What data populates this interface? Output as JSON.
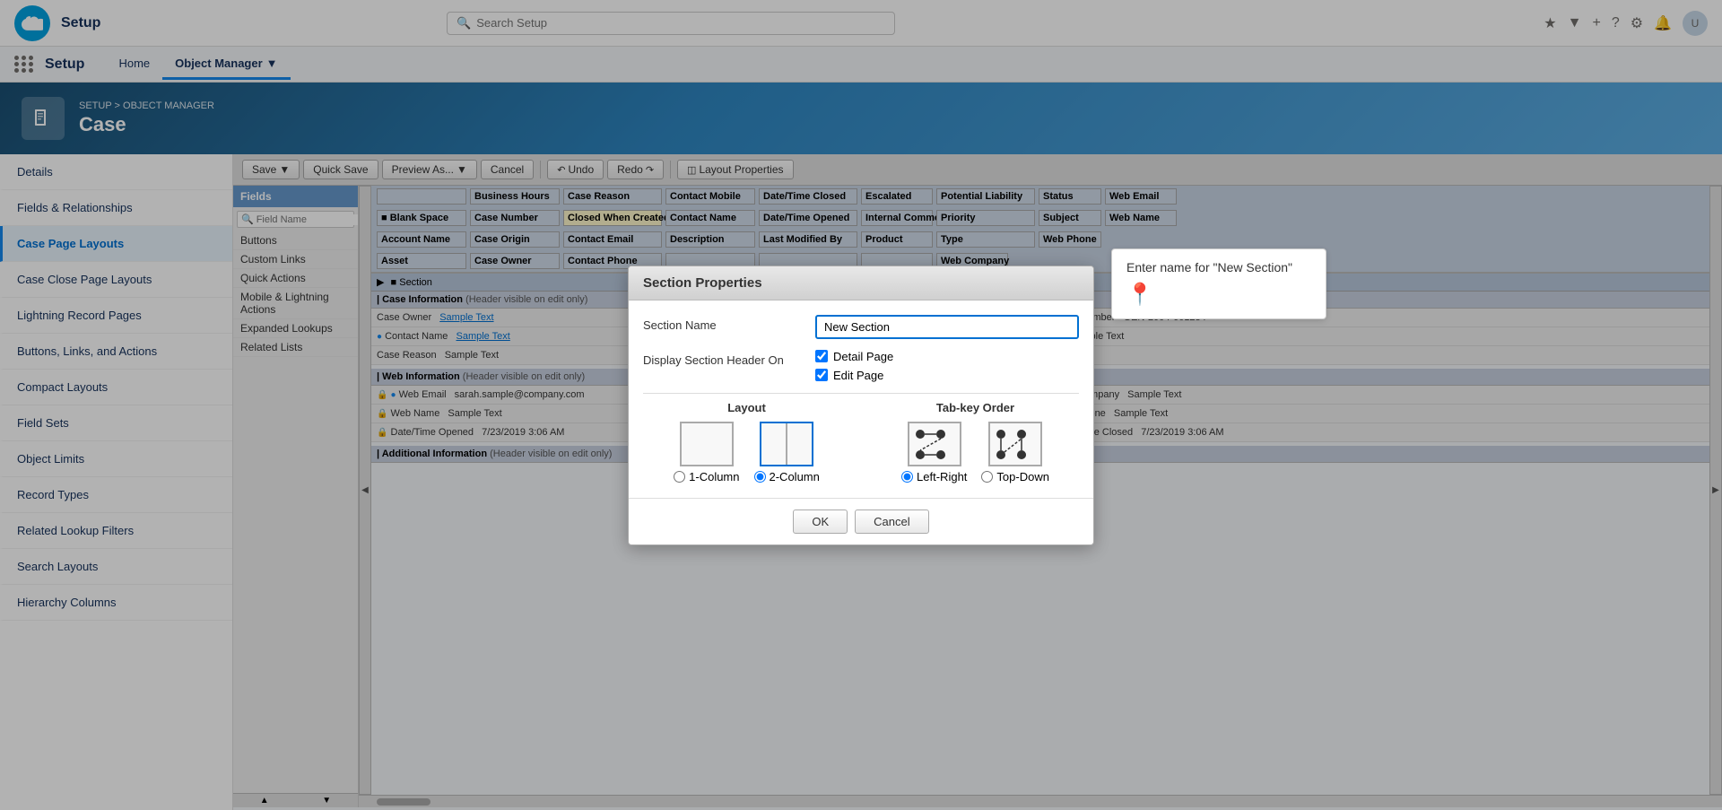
{
  "app": {
    "title": "Setup"
  },
  "topnav": {
    "search_placeholder": "Search Setup",
    "home_label": "Home",
    "object_manager_label": "Object Manager"
  },
  "breadcrumb": {
    "setup_label": "SETUP",
    "object_manager_label": "OBJECT MANAGER",
    "separator": ">"
  },
  "page": {
    "title": "Case"
  },
  "sidebar": {
    "items": [
      {
        "id": "details",
        "label": "Details"
      },
      {
        "id": "fields-relationships",
        "label": "Fields & Relationships"
      },
      {
        "id": "case-page-layouts",
        "label": "Case Page Layouts",
        "active": true
      },
      {
        "id": "case-close-page-layouts",
        "label": "Case Close Page Layouts"
      },
      {
        "id": "lightning-record-pages",
        "label": "Lightning Record Pages"
      },
      {
        "id": "buttons-links-actions",
        "label": "Buttons, Links, and Actions"
      },
      {
        "id": "compact-layouts",
        "label": "Compact Layouts"
      },
      {
        "id": "field-sets",
        "label": "Field Sets"
      },
      {
        "id": "object-limits",
        "label": "Object Limits"
      },
      {
        "id": "record-types",
        "label": "Record Types"
      },
      {
        "id": "related-lookup-filters",
        "label": "Related Lookup Filters"
      },
      {
        "id": "search-layouts",
        "label": "Search Layouts"
      },
      {
        "id": "hierarchy-columns",
        "label": "Hierarchy Columns"
      }
    ]
  },
  "toolbar": {
    "save_label": "Save",
    "quick_save_label": "Quick Save",
    "preview_as_label": "Preview As...",
    "cancel_label": "Cancel",
    "undo_label": "Undo",
    "redo_label": "Redo",
    "layout_properties_label": "Layout Properties"
  },
  "fields_panel": {
    "header": "Fields",
    "quick_find_placeholder": "Field Name",
    "items": [
      "Buttons",
      "Custom Links",
      "Quick Actions",
      "Mobile & Lightning Actions",
      "Expanded Lookups",
      "Related Lists"
    ]
  },
  "layout_header_cells": [
    "",
    "Business Hours",
    "Case Reason",
    "Contact Mobile",
    "Date/Time Closed",
    "Escalated",
    "Potential Liability",
    "Status",
    "Web Email",
    "",
    "Case Number",
    "Closed When Created",
    "Contact Name",
    "Date/Time Opened",
    "Internal Comments",
    "Priority",
    "Subject",
    "Web Name",
    "",
    "Account Name",
    "Case Origin",
    "Contact Email",
    "Description",
    "Last Modified By",
    "Product",
    "Type",
    "Web Phone",
    "",
    "Asset",
    "Case Owner",
    "Contact Phone",
    "",
    "",
    "",
    "",
    "Web Company"
  ],
  "sections": {
    "case_information": {
      "label": "Case Information",
      "note": "(Header visible on edit only)",
      "fields": [
        {
          "label": "Case Owner",
          "value": "Sample Text",
          "has_lock": false,
          "has_dot": false,
          "is_link": true
        },
        {
          "label": "Case Number",
          "value": "GEN-2004-001234",
          "has_lock": true,
          "has_dot": false,
          "is_link": false
        },
        {
          "label": "Contact Name",
          "value": "Sample Text",
          "has_lock": false,
          "has_dot": true,
          "is_link": true
        },
        {
          "label": "Type",
          "value": "Sample Text",
          "has_lock": false,
          "has_dot": false,
          "is_link": false
        },
        {
          "label": "Case Reason",
          "value": "Sample Text",
          "has_lock": false,
          "has_dot": false,
          "is_link": false
        }
      ]
    },
    "web_information": {
      "label": "Web Information",
      "note": "(Header visible on edit only)",
      "fields_left": [
        {
          "label": "Web Email",
          "value": "sarah.sample@company.com",
          "has_lock": true,
          "has_dot": true
        },
        {
          "label": "Web Name",
          "value": "Sample Text",
          "has_lock": true,
          "has_dot": false
        },
        {
          "label": "Date/Time Opened",
          "value": "7/23/2019 3:06 AM",
          "has_lock": true,
          "has_dot": false
        }
      ],
      "fields_right": [
        {
          "label": "Web Company",
          "value": "Sample Text",
          "has_lock": true,
          "has_dot": false
        },
        {
          "label": "Web Phone",
          "value": "Sample Text",
          "has_lock": true,
          "has_dot": false
        },
        {
          "label": "Date/Time Closed",
          "value": "7/23/2019 3:06 AM",
          "has_lock": true,
          "has_dot": false
        }
      ]
    },
    "additional_information": {
      "label": "Additional Information",
      "note": "(Header visible on edit only)"
    }
  },
  "modal": {
    "title": "Section Properties",
    "section_name_label": "Section Name",
    "section_name_value": "New Section",
    "display_header_label": "Display Section Header On",
    "detail_page_label": "Detail Page",
    "detail_page_checked": true,
    "edit_page_label": "Edit Page",
    "edit_page_checked": true,
    "layout_title": "Layout",
    "col1_label": "1-Column",
    "col2_label": "2-Column",
    "tab_order_title": "Tab-key Order",
    "left_right_label": "Left-Right",
    "top_down_label": "Top-Down",
    "ok_label": "OK",
    "cancel_label": "Cancel"
  },
  "tooltip": {
    "text": "Enter name for \"New Section\""
  }
}
